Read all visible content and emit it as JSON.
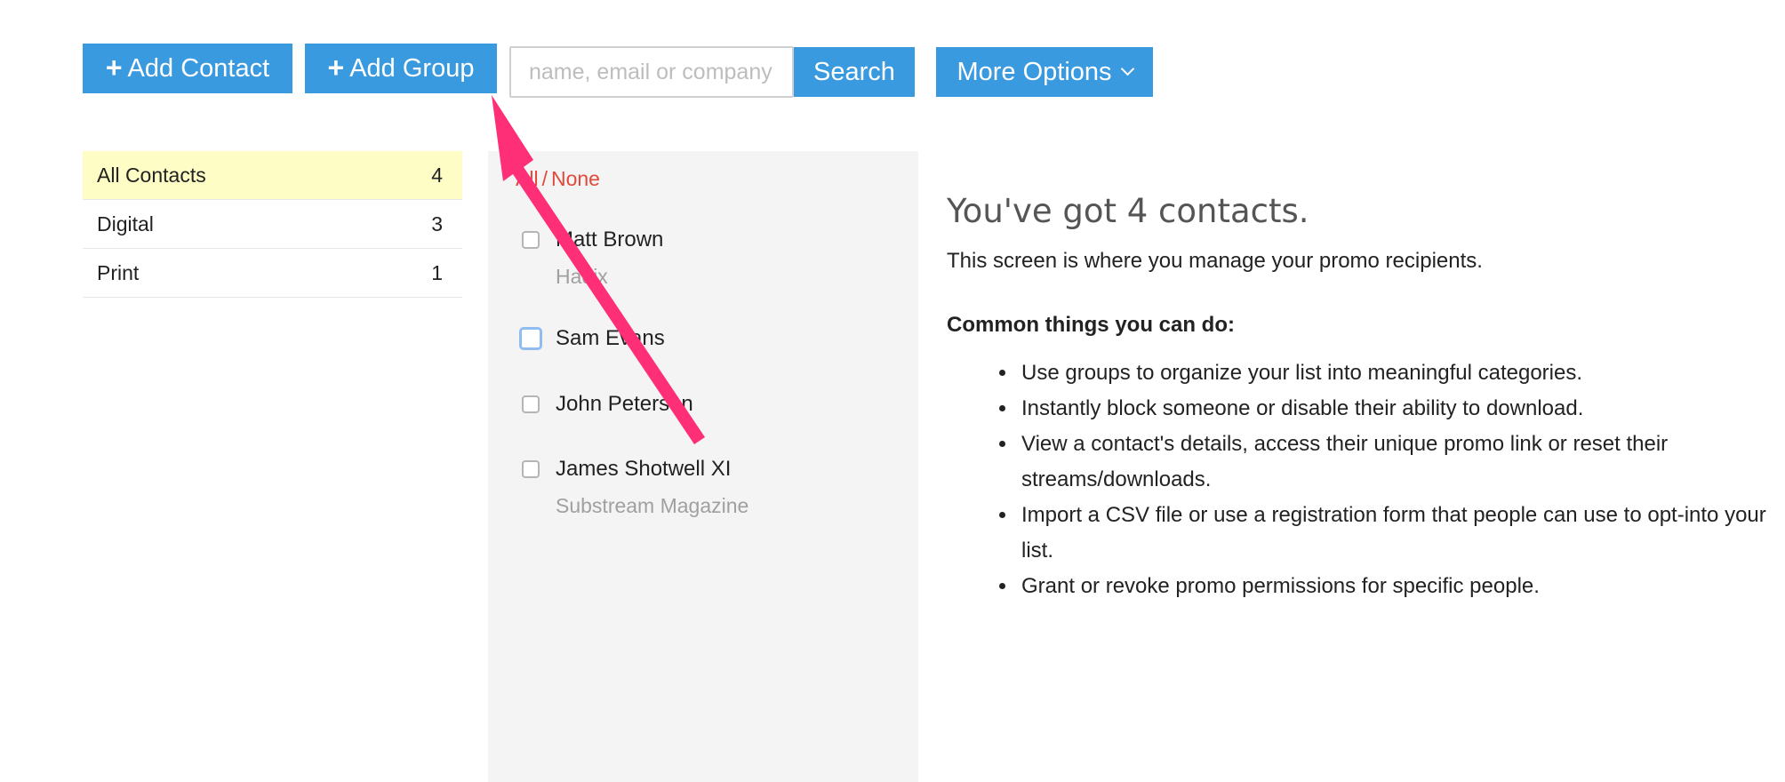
{
  "toolbar": {
    "add_contact_label": "Add Contact",
    "add_group_label": "Add Group",
    "search_placeholder": "name, email or company",
    "search_value": "",
    "search_button_label": "Search",
    "more_options_label": "More Options"
  },
  "groups": [
    {
      "name": "All Contacts",
      "count": "4",
      "active": true
    },
    {
      "name": "Digital",
      "count": "3",
      "active": false
    },
    {
      "name": "Print",
      "count": "1",
      "active": false
    }
  ],
  "contacts_panel": {
    "select_all_label": "All",
    "select_separator": "/",
    "select_none_label": "None",
    "contacts": [
      {
        "name": "Matt Brown",
        "company": "Hadix"
      },
      {
        "name": "Sam Evans",
        "company": ""
      },
      {
        "name": "John Peterson",
        "company": ""
      },
      {
        "name": "James Shotwell XI",
        "company": "Substream Magazine"
      }
    ]
  },
  "info": {
    "title": "You've got 4 contacts.",
    "description": "This screen is where you manage your promo recipients.",
    "subheading": "Common things you can do:",
    "tips": [
      "Use groups to organize your list into meaningful categories.",
      "Instantly block someone or disable their ability to download.",
      "View a contact's details, access their unique promo link or reset their streams/downloads.",
      "Import a CSV file or use a registration form that people can use to opt-into your list.",
      "Grant or revoke promo permissions for specific people."
    ]
  },
  "icons": {
    "plus": "plus-icon",
    "chevron": "chevron-down-icon",
    "annotation": "annotation-arrow-icon"
  },
  "colors": {
    "button_blue": "#3a9ae0",
    "active_group_bg": "#fdfdc5",
    "select_link_red": "#e04a3c",
    "annotation_arrow": "#fe2f76",
    "panel_gray": "#f4f4f4"
  }
}
